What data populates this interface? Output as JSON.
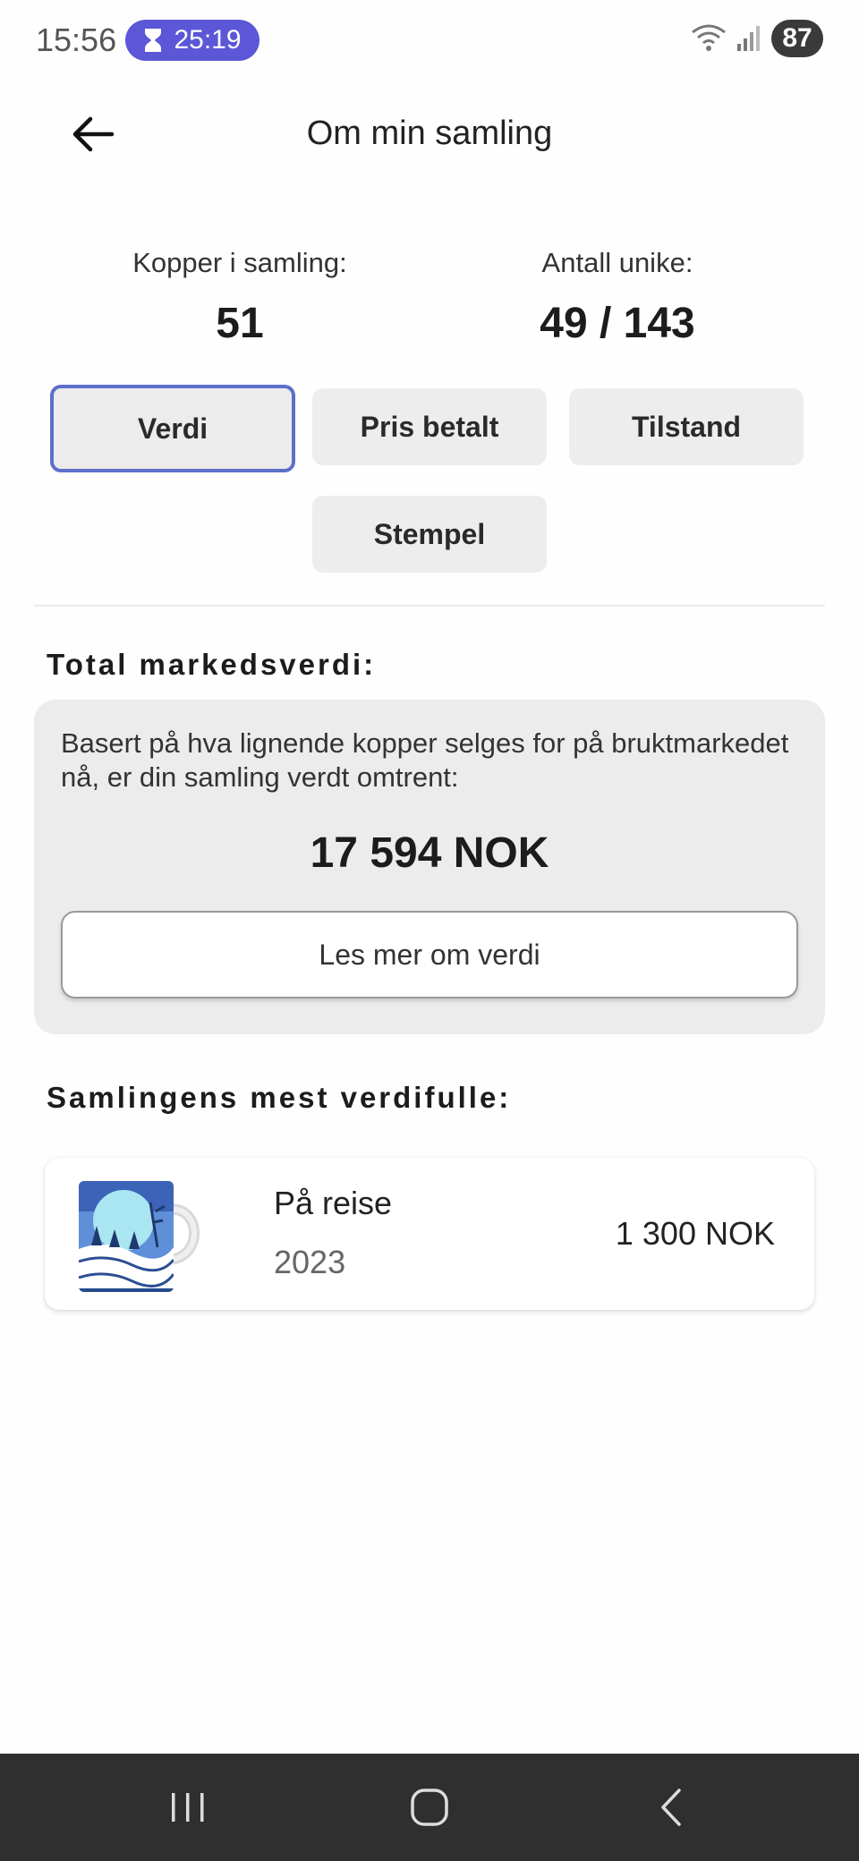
{
  "status_bar": {
    "time": "15:56",
    "timer": "25:19",
    "battery": "87",
    "icons": [
      "hourglass-icon",
      "wifi-icon",
      "signal-icon",
      "battery-icon"
    ]
  },
  "header": {
    "title": "Om min samling",
    "back_icon": "arrow-left-icon"
  },
  "stats": {
    "cups_label": "Kopper i samling:",
    "cups_value": "51",
    "unique_label": "Antall unike:",
    "unique_value": "49 / 143"
  },
  "tabs": [
    {
      "label": "Verdi",
      "active": true
    },
    {
      "label": "Pris betalt",
      "active": false
    },
    {
      "label": "Tilstand",
      "active": false
    },
    {
      "label": "Stempel",
      "active": false
    }
  ],
  "market_value": {
    "heading": "Total markedsverdi:",
    "description": "Basert på hva lignende kopper selges for på bruktmarkedet nå, er din samling verdt omtrent:",
    "amount": "17 594 NOK",
    "button_label": "Les mer om verdi"
  },
  "most_valuable": {
    "heading": "Samlingens mest verdifulle:",
    "items": [
      {
        "name": "På reise",
        "year": "2023",
        "price": "1 300 NOK",
        "image": "mug-image"
      }
    ]
  },
  "nav_bar": {
    "icons": [
      "recent-apps-icon",
      "home-icon",
      "back-icon"
    ]
  },
  "colors": {
    "accent": "#5d6fc9",
    "timer_pill": "#5b57d6",
    "card_bg": "#ececec",
    "nav_bg": "#2f2f2f"
  }
}
